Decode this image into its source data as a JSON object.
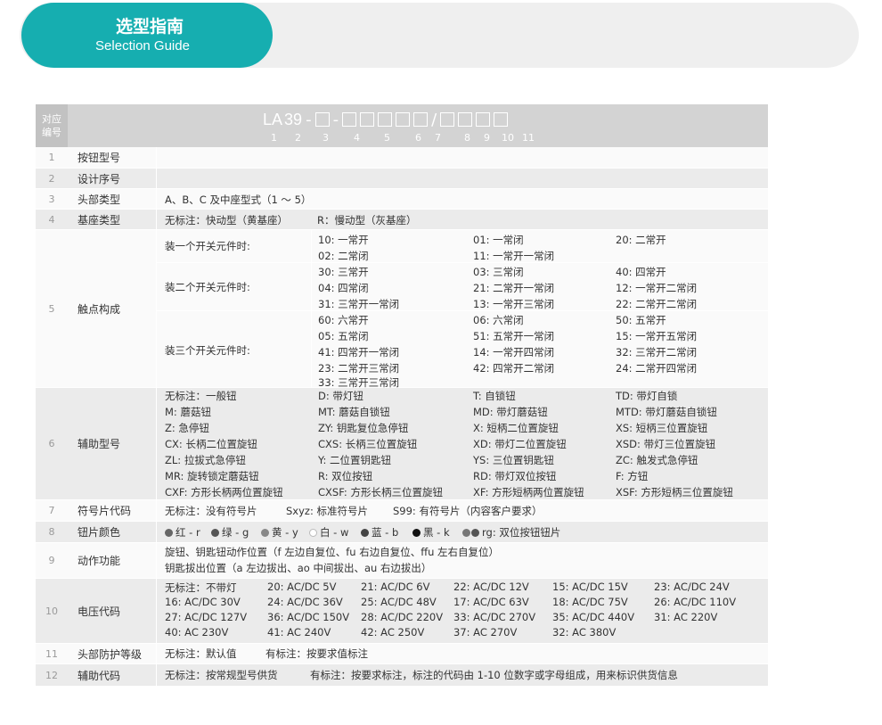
{
  "header": {
    "title_cn": "选型指南",
    "title_en": "Selection Guide"
  },
  "table_head": {
    "num_label": "对应编号",
    "model_prefix": "LA",
    "model_num": "39",
    "index_numbers": [
      "1",
      "2",
      "3",
      "4",
      "5",
      "6",
      "7",
      "8",
      "9",
      "10",
      "11"
    ]
  },
  "rows": {
    "r1": {
      "num": "1",
      "name": "按钮型号"
    },
    "r2": {
      "num": "2",
      "name": "设计序号"
    },
    "r3": {
      "num": "3",
      "name": "头部类型",
      "val": "A、B、C 及中座型式（1 ～ 5）"
    },
    "r4": {
      "num": "4",
      "name": "基座类型",
      "v1": "无标注：快动型（黄基座）",
      "v2": "R：慢动型（灰基座）"
    },
    "r5": {
      "num": "5",
      "name": "触点构成",
      "g1": {
        "label": "装一个开关元件时:",
        "items": [
          "10: 一常开",
          "01: 一常闭",
          "20: 二常开",
          "02: 二常闭",
          "11: 一常开一常闭"
        ]
      },
      "g2": {
        "label": "装二个开关元件时:",
        "items": [
          "30: 三常开",
          "03: 三常闭",
          "40: 四常开",
          "04: 四常闭",
          "21: 二常开一常闭",
          "12: 一常开二常闭",
          "31: 三常开一常闭",
          "13: 一常开三常闭",
          "22: 二常开二常闭"
        ]
      },
      "g3": {
        "label": "装三个开关元件时:",
        "items": [
          "60: 六常开",
          "06: 六常闭",
          "50: 五常开",
          "05: 五常闭",
          "51: 五常开一常闭",
          "15: 一常开五常闭",
          "41: 四常开一常闭",
          "14: 一常开四常闭",
          "32: 三常开二常闭",
          "23: 二常开三常闭",
          "42: 四常开二常闭",
          "24: 二常开四常闭",
          "33: 三常开三常闭"
        ]
      }
    },
    "r6": {
      "num": "6",
      "name": "辅助型号",
      "items": [
        "无标注：一般钮",
        "D: 带灯钮",
        "T: 自锁钮",
        "TD: 带灯自锁",
        "M: 蘑菇钮",
        "MT: 蘑菇自锁钮",
        "MD: 带灯蘑菇钮",
        "MTD: 带灯蘑菇自锁钮",
        "Z: 急停钮",
        "ZY: 钥匙复位急停钮",
        "X: 短柄二位置旋钮",
        "XS: 短柄三位置旋钮",
        "CX: 长柄二位置旋钮",
        "CXS: 长柄三位置旋钮",
        "XD: 带灯二位置旋钮",
        "XSD: 带灯三位置旋钮",
        "ZL: 拉拔式急停钮",
        "Y: 二位置钥匙钮",
        "YS: 三位置钥匙钮",
        "ZC: 触发式急停钮",
        "MR: 旋转锁定蘑菇钮",
        "R: 双位按钮",
        "RD: 带灯双位按钮",
        "F: 方钮",
        "CXF: 方形长柄两位置旋钮",
        "CXSF: 方形长柄三位置旋钮",
        "XF: 方形短柄两位置旋钮",
        "XSF: 方形短柄三位置旋钮"
      ]
    },
    "r7": {
      "num": "7",
      "name": "符号片代码",
      "v1": "无标注：没有符号片",
      "v2": "Sxyz: 标准符号片",
      "v3": "S99: 有符号片（内容客户要求）"
    },
    "r8": {
      "num": "8",
      "name": "钮片颜色",
      "colors": [
        {
          "label": "红 - r",
          "hex": "#666666"
        },
        {
          "label": "绿 - g",
          "hex": "#555555"
        },
        {
          "label": "黄 - y",
          "hex": "#888888"
        },
        {
          "label": "白 - w",
          "hex": "#ffffff"
        },
        {
          "label": "蓝 - b",
          "hex": "#444444"
        },
        {
          "label": "黑 - k",
          "hex": "#111111"
        }
      ],
      "double_label": "rg: 双位按钮钮片"
    },
    "r9": {
      "num": "9",
      "name": "动作功能",
      "l1": "旋钮、钥匙钮动作位置（f 左边自复位、fu 右边自复位、ffu 左右自复位）",
      "l2": "钥匙拔出位置（a 左边拔出、ao 中间拔出、au 右边拔出）"
    },
    "r10": {
      "num": "10",
      "name": "电压代码",
      "items": [
        "无标注：不带灯",
        "20: AC/DC 5V",
        "21: AC/DC 6V",
        "22: AC/DC 12V",
        "15: AC/DC  15V",
        "23: AC/DC 24V",
        "16: AC/DC 30V",
        "24: AC/DC 36V",
        "25: AC/DC 48V",
        "17: AC/DC 63V",
        "18: AC/DC 75V",
        "26: AC/DC 110V",
        "27: AC/DC 127V",
        "36: AC/DC 150V",
        "28: AC/DC 220V",
        "33: AC/DC 270V",
        "35: AC/DC 440V",
        "31: AC 220V",
        "40: AC 230V",
        "41: AC 240V",
        "42: AC 250V",
        "37: AC 270V",
        "32: AC 380V"
      ]
    },
    "r11": {
      "num": "11",
      "name": "头部防护等级",
      "v1": "无标注：默认值",
      "v2": "有标注：按要求值标注"
    },
    "r12": {
      "num": "12",
      "name": "辅助代码",
      "v1": "无标注：按常规型号供货",
      "v2": "有标注：按要求标注，标注的代码由 1-10 位数字或字母组成，用来标识供货信息"
    }
  }
}
